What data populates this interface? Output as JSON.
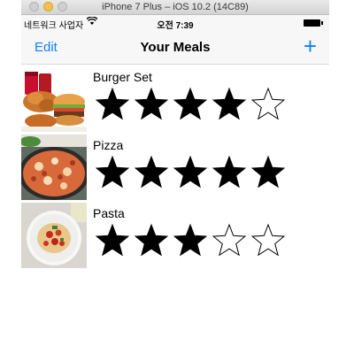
{
  "window": {
    "title": "iPhone 7 Plus – iOS 10.2 (14C89)"
  },
  "status_bar": {
    "carrier": "네트워크 사업자",
    "time": "오전 7:39"
  },
  "nav": {
    "edit_label": "Edit",
    "title": "Your Meals",
    "add_label": "+"
  },
  "meals": [
    {
      "name": "Burger Set",
      "rating": 4,
      "max_rating": 5,
      "photo": "burger-photo"
    },
    {
      "name": "Pizza",
      "rating": 5,
      "max_rating": 5,
      "photo": "pizza-photo"
    },
    {
      "name": "Pasta",
      "rating": 3,
      "max_rating": 5,
      "photo": "pasta-photo"
    }
  ],
  "colors": {
    "accent": "#147efb",
    "star": "#000000"
  }
}
